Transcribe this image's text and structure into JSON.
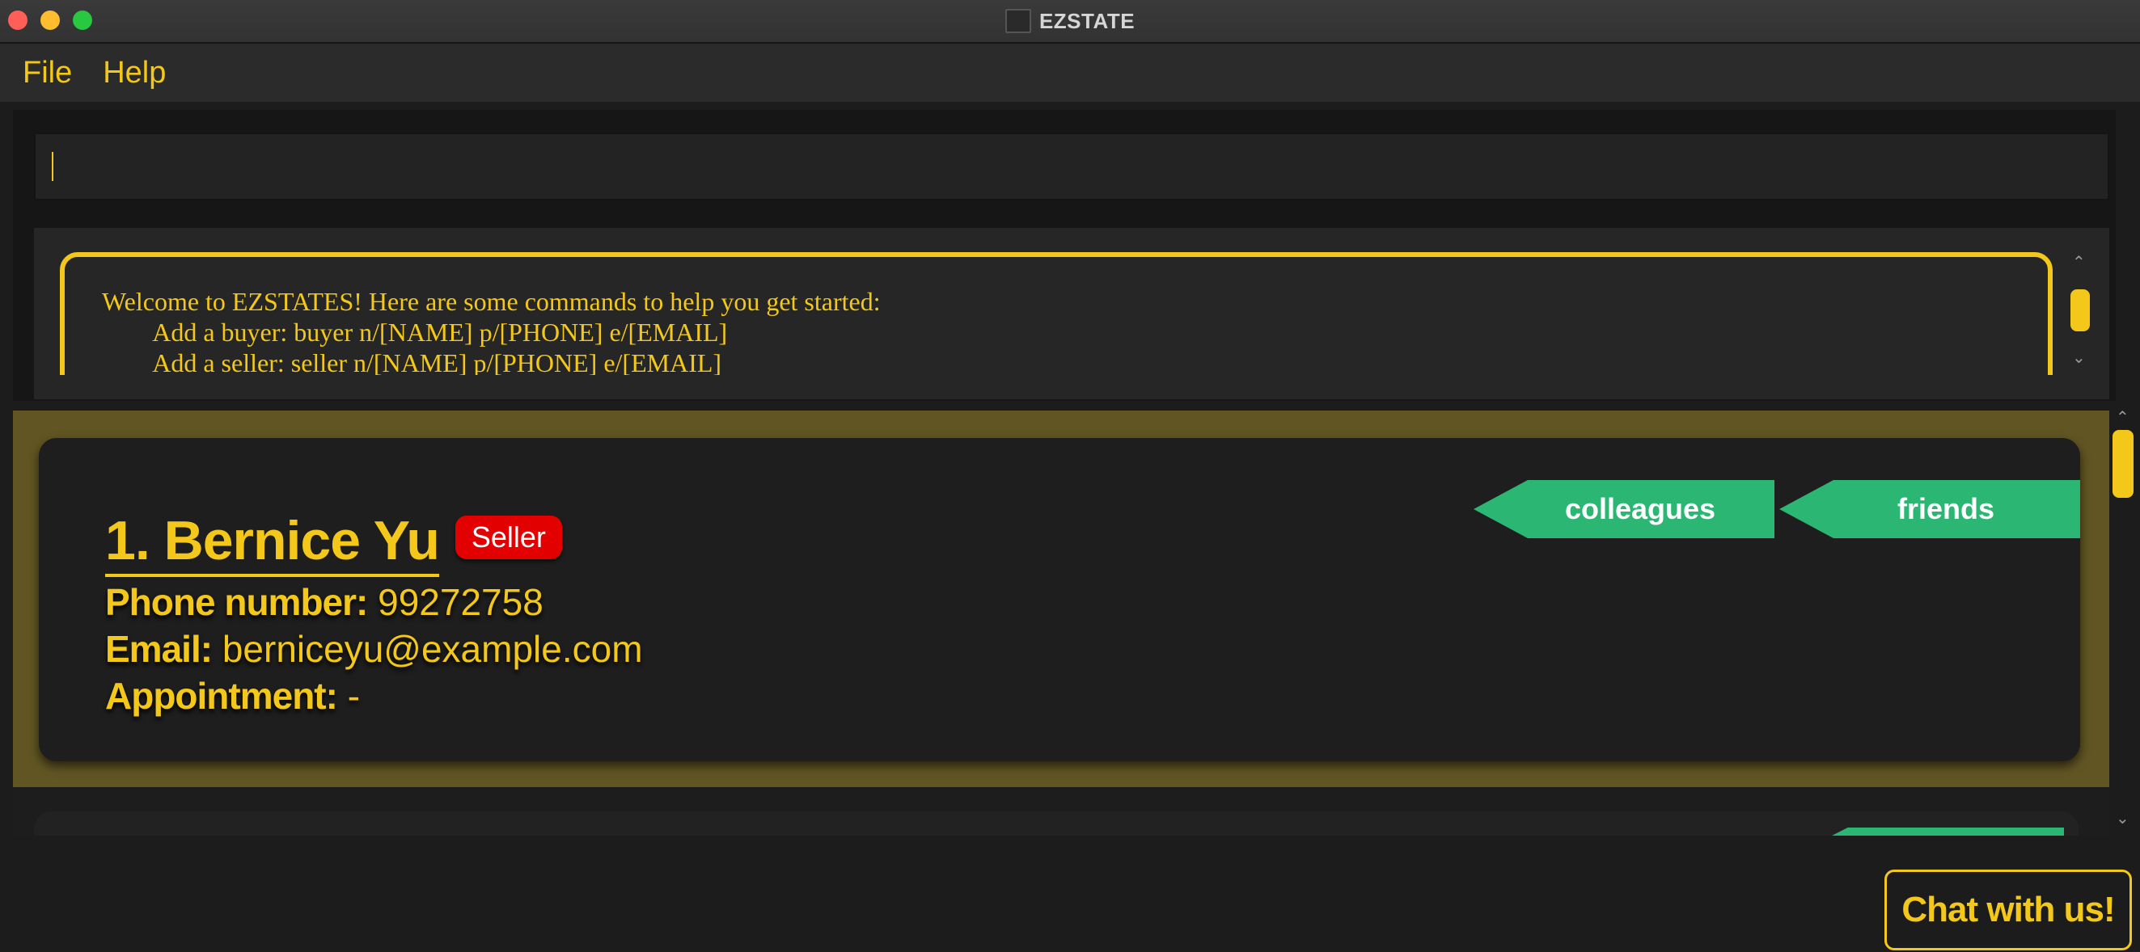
{
  "window": {
    "title": "EZSTATE",
    "app_icon": "ezstate-app-icon"
  },
  "menu": {
    "items": [
      {
        "label": "File"
      },
      {
        "label": "Help"
      }
    ]
  },
  "command_box": {
    "value": "",
    "placeholder": ""
  },
  "result_display": {
    "text": "Welcome to EZSTATES! Here are some commands to help you get started:\n        Add a buyer: buyer n/[NAME] p/[PHONE] e/[EMAIL]\n        Add a seller: seller n/[NAME] p/[PHONE] e/[EMAIL]"
  },
  "persons": [
    {
      "name": "1.  Bernice Yu",
      "role": "Seller",
      "phone_label": "Phone number:",
      "phone": "99272758",
      "email_label": "Email:",
      "email": "berniceyu@example.com",
      "appointment_label": "Appointment:",
      "appointment": "-",
      "tags": [
        "colleagues",
        "friends"
      ]
    }
  ],
  "chat_button": {
    "label": "Chat with us!"
  },
  "colors": {
    "accent": "#f3c81a",
    "tag": "#2bb673",
    "seller_badge": "#e30000",
    "selected_row": "#615523"
  }
}
